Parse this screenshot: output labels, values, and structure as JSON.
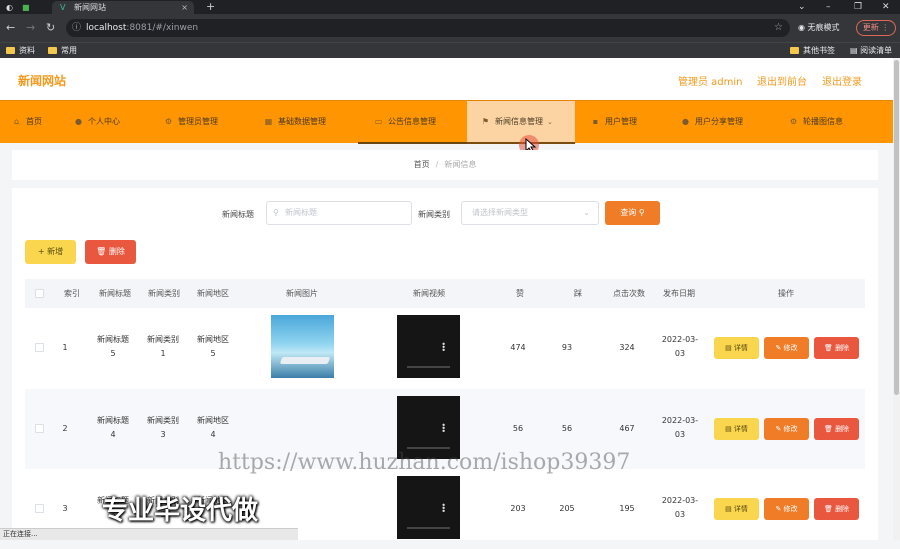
{
  "browser": {
    "tab_title": "新闻网站",
    "url_host": "localhost",
    "url_path": ":8081/#/xinwen",
    "incognito_label": "无痕模式",
    "update_label": "更新",
    "bookmarks": [
      "资料",
      "常用"
    ],
    "bookmarks_right": [
      "其他书签",
      "阅读清单"
    ],
    "status_text": "正在连接..."
  },
  "header": {
    "site_title": "新闻网站",
    "admin_label": "管理员 admin",
    "frontend_link": "退出到前台",
    "logout_link": "退出登录"
  },
  "nav": {
    "items": [
      {
        "label": "首页",
        "icon": "home-icon"
      },
      {
        "label": "个人中心",
        "icon": "user-icon"
      },
      {
        "label": "管理员管理",
        "icon": "settings-icon"
      },
      {
        "label": "基础数据管理",
        "icon": "grid-icon"
      },
      {
        "label": "公告信息管理",
        "icon": "notice-icon"
      },
      {
        "label": "新闻信息管理",
        "icon": "flag-icon"
      },
      {
        "label": "用户管理",
        "icon": "users-icon"
      },
      {
        "label": "用户分享管理",
        "icon": "share-icon"
      },
      {
        "label": "轮播图信息",
        "icon": "image-icon"
      }
    ],
    "active_index": 5
  },
  "breadcrumb": {
    "home": "首页",
    "separator": "/",
    "current": "新闻信息"
  },
  "filters": {
    "title_label": "新闻标题",
    "title_placeholder": "新闻标题",
    "type_label": "新闻类别",
    "type_placeholder": "请选择新闻类型",
    "search_label": "查询"
  },
  "actions": {
    "add_label": "新增",
    "delete_label": "删除"
  },
  "table": {
    "headers": [
      "索引",
      "新闻标题",
      "新闻类别",
      "新闻地区",
      "新闻图片",
      "新闻视频",
      "赞",
      "踩",
      "点击次数",
      "发布日期",
      "操作"
    ],
    "rows": [
      {
        "index": "1",
        "title": "新闻标题5",
        "type": "新闻类别1",
        "region": "新闻地区5",
        "has_image": true,
        "likes": "474",
        "dislikes": "93",
        "clicks": "324",
        "date": "2022-03-03"
      },
      {
        "index": "2",
        "title": "新闻标题4",
        "type": "新闻类别3",
        "region": "新闻地区4",
        "has_image": false,
        "likes": "56",
        "dislikes": "56",
        "clicks": "467",
        "date": "2022-03-03"
      },
      {
        "index": "3",
        "title": "新闻标题3",
        "type": "新闻类别3",
        "region": "新闻地区3",
        "has_image": false,
        "likes": "203",
        "dislikes": "205",
        "clicks": "195",
        "date": "2022-03-03"
      }
    ],
    "row_actions": {
      "detail": "详情",
      "edit": "修改",
      "delete": "删除"
    }
  },
  "overlay": {
    "watermark": "https://www.huzhan.com/ishop39397",
    "promo": "专业毕设代做"
  }
}
